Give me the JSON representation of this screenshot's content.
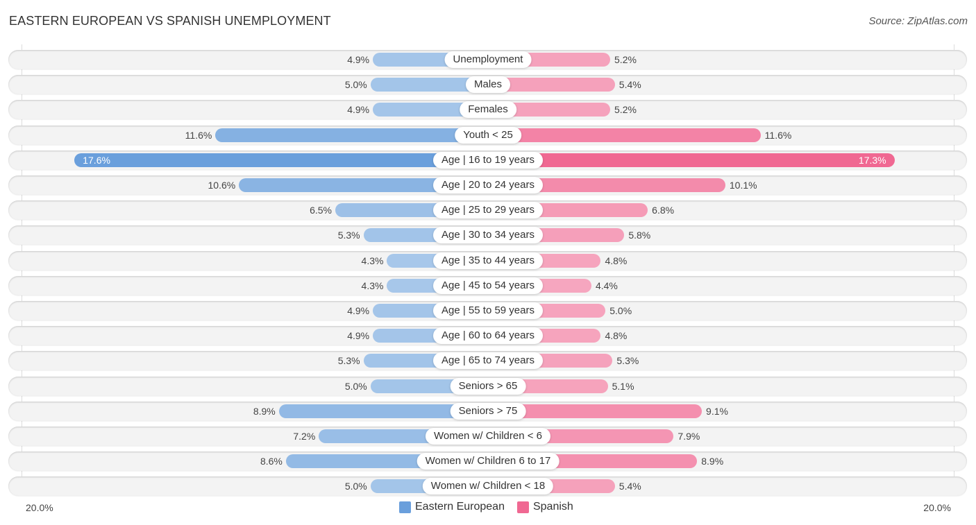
{
  "header": {
    "title": "EASTERN EUROPEAN VS SPANISH UNEMPLOYMENT",
    "source": "Source: ZipAtlas.com"
  },
  "colors": {
    "eastern_european": "#6a9fdc",
    "eastern_european_light": "#a8c8ea",
    "spanish": "#f06892",
    "spanish_light": "#f6a8c0"
  },
  "chart_data": {
    "type": "bar",
    "orientation": "horizontal-diverging",
    "title": "EASTERN EUROPEAN VS SPANISH UNEMPLOYMENT",
    "xlabel": "",
    "ylabel": "",
    "xlim": [
      -20,
      20
    ],
    "axis_labels": {
      "left": "20.0%",
      "right": "20.0%"
    },
    "legend_position": "bottom-center",
    "categories": [
      "Unemployment",
      "Males",
      "Females",
      "Youth < 25",
      "Age | 16 to 19 years",
      "Age | 20 to 24 years",
      "Age | 25 to 29 years",
      "Age | 30 to 34 years",
      "Age | 35 to 44 years",
      "Age | 45 to 54 years",
      "Age | 55 to 59 years",
      "Age | 60 to 64 years",
      "Age | 65 to 74 years",
      "Seniors > 65",
      "Seniors > 75",
      "Women w/ Children < 6",
      "Women w/ Children 6 to 17",
      "Women w/ Children < 18"
    ],
    "series": [
      {
        "name": "Eastern European",
        "side": "left",
        "values": [
          4.9,
          5.0,
          4.9,
          11.6,
          17.6,
          10.6,
          6.5,
          5.3,
          4.3,
          4.3,
          4.9,
          4.9,
          5.3,
          5.0,
          8.9,
          7.2,
          8.6,
          5.0
        ],
        "labels": [
          "4.9%",
          "5.0%",
          "4.9%",
          "11.6%",
          "17.6%",
          "10.6%",
          "6.5%",
          "5.3%",
          "4.3%",
          "4.3%",
          "4.9%",
          "4.9%",
          "5.3%",
          "5.0%",
          "8.9%",
          "7.2%",
          "8.6%",
          "5.0%"
        ]
      },
      {
        "name": "Spanish",
        "side": "right",
        "values": [
          5.2,
          5.4,
          5.2,
          11.6,
          17.3,
          10.1,
          6.8,
          5.8,
          4.8,
          4.4,
          5.0,
          4.8,
          5.3,
          5.1,
          9.1,
          7.9,
          8.9,
          5.4
        ],
        "labels": [
          "5.2%",
          "5.4%",
          "5.2%",
          "11.6%",
          "17.3%",
          "10.1%",
          "6.8%",
          "5.8%",
          "4.8%",
          "4.4%",
          "5.0%",
          "4.8%",
          "5.3%",
          "5.1%",
          "9.1%",
          "7.9%",
          "8.9%",
          "5.4%"
        ]
      }
    ]
  },
  "legend": {
    "items": [
      {
        "label": "Eastern European"
      },
      {
        "label": "Spanish"
      }
    ]
  }
}
